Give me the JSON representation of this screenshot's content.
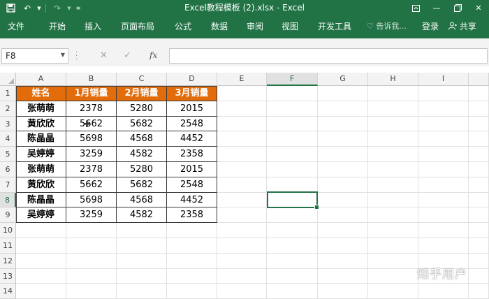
{
  "window": {
    "title": "Excel教程模板 (2).xlsx - Excel"
  },
  "ribbon": {
    "tabs": [
      "文件",
      "开始",
      "插入",
      "页面布局",
      "公式",
      "数据",
      "审阅",
      "视图",
      "开发工具"
    ],
    "tell_me": "告诉我...",
    "login": "登录",
    "share": "共享"
  },
  "formula_bar": {
    "name_box": "F8",
    "fx": "fx",
    "value": ""
  },
  "sheet": {
    "columns": [
      "A",
      "B",
      "C",
      "D",
      "E",
      "F",
      "G",
      "H",
      "I"
    ],
    "rows": [
      "1",
      "2",
      "3",
      "4",
      "5",
      "6",
      "7",
      "8",
      "9",
      "10",
      "11",
      "12",
      "13",
      "14"
    ],
    "selected_cell": "F8",
    "table": [
      [
        "姓名",
        "1月销量",
        "2月销量",
        "3月销量"
      ],
      [
        "张萌萌",
        "2378",
        "5280",
        "2015"
      ],
      [
        "黄欣欣",
        "5662",
        "5682",
        "2548"
      ],
      [
        "陈晶晶",
        "5698",
        "4568",
        "4452"
      ],
      [
        "吴婷婷",
        "3259",
        "4582",
        "2358"
      ],
      [
        "张萌萌",
        "2378",
        "5280",
        "2015"
      ],
      [
        "黄欣欣",
        "5662",
        "5682",
        "2548"
      ],
      [
        "陈晶晶",
        "5698",
        "4568",
        "4452"
      ],
      [
        "吴婷婷",
        "3259",
        "4582",
        "2358"
      ]
    ]
  },
  "watermark": "知乎用户",
  "colors": {
    "excel_green": "#217346",
    "header_fill": "#e26b0a"
  }
}
